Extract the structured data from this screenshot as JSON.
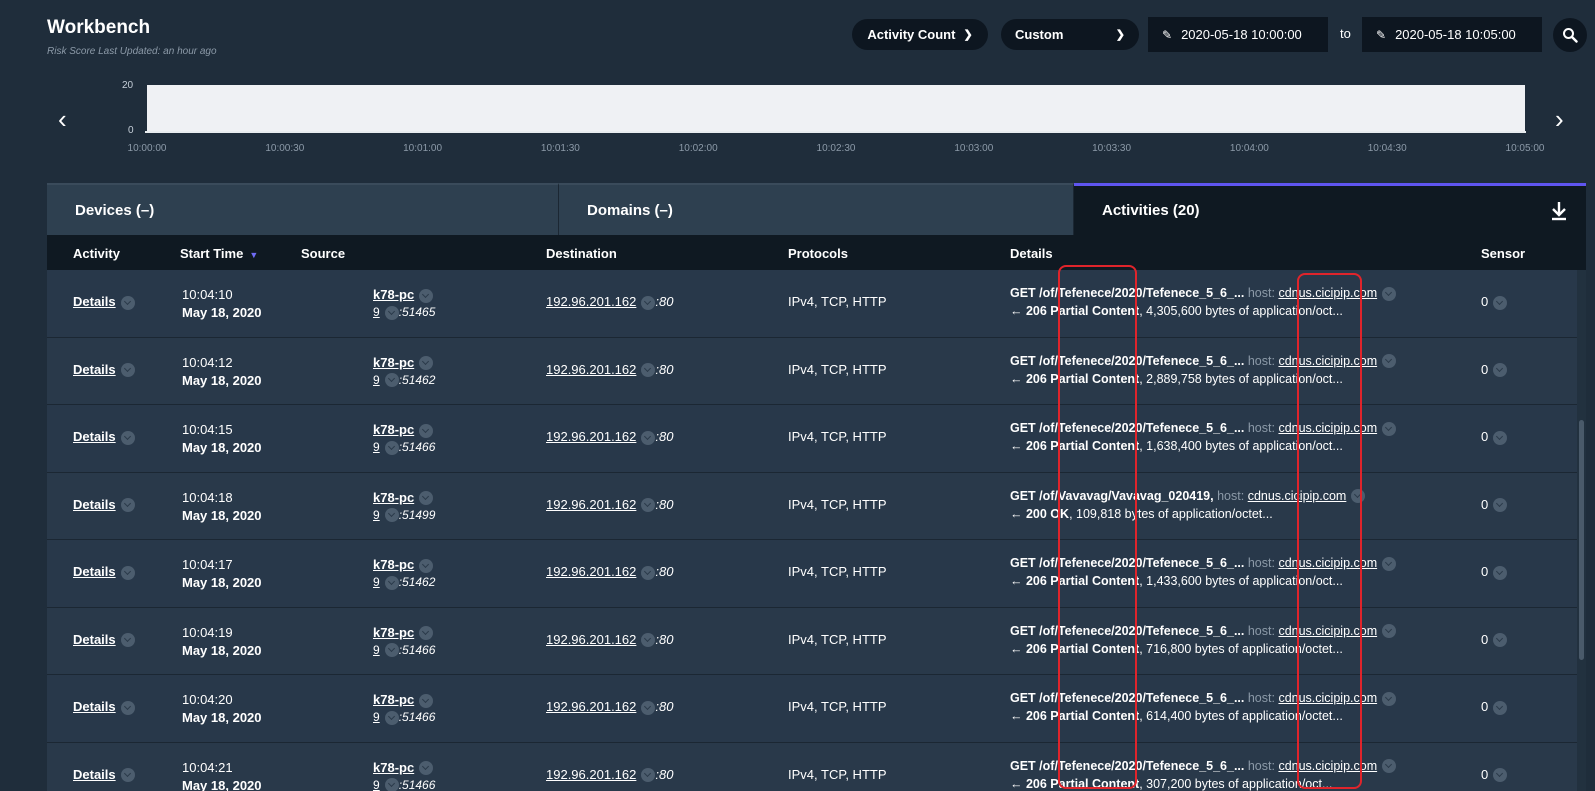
{
  "header": {
    "title": "Workbench",
    "subtitle": "Risk Score Last Updated: an hour ago"
  },
  "controls": {
    "metric_label": "Activity Count",
    "range_label": "Custom",
    "date_from": "2020-05-18 10:00:00",
    "to_label": "to",
    "date_to": "2020-05-18 10:05:00"
  },
  "timeline": {
    "y_ticks": [
      "20",
      "0"
    ],
    "x_ticks": [
      "10:00:00",
      "10:00:30",
      "10:01:00",
      "10:01:30",
      "10:02:00",
      "10:02:30",
      "10:03:00",
      "10:03:30",
      "10:04:00",
      "10:04:30",
      "10:05:00"
    ]
  },
  "tabs": {
    "devices": "Devices (–)",
    "domains": "Domains (–)",
    "activities": "Activities (20)"
  },
  "columns": {
    "activity": "Activity",
    "start_time": "Start Time",
    "source": "Source",
    "destination": "Destination",
    "protocols": "Protocols",
    "details": "Details",
    "sensor": "Sensor"
  },
  "rows": [
    {
      "link": "Details",
      "time": "10:04:10",
      "date": "May 18, 2020",
      "src_host": "k78-pc",
      "src_id": "9",
      "src_port": ":51465",
      "dst_ip": "192.96.201.162",
      "dst_port": ":80",
      "protocols": "IPv4, TCP, HTTP",
      "req": "GET /of/Tefenece/2020/Tefenece_5_6_...",
      "host_label": "host:",
      "host": "cdnus.cicipip.com",
      "status": "← 206 Partial Content",
      "resp": ", 4,305,600 bytes of application/oct...",
      "sensor": "0"
    },
    {
      "link": "Details",
      "time": "10:04:12",
      "date": "May 18, 2020",
      "src_host": "k78-pc",
      "src_id": "9",
      "src_port": ":51462",
      "dst_ip": "192.96.201.162",
      "dst_port": ":80",
      "protocols": "IPv4, TCP, HTTP",
      "req": "GET /of/Tefenece/2020/Tefenece_5_6_...",
      "host_label": "host:",
      "host": "cdnus.cicipip.com",
      "status": "← 206 Partial Content",
      "resp": ", 2,889,758 bytes of application/oct...",
      "sensor": "0"
    },
    {
      "link": "Details",
      "time": "10:04:15",
      "date": "May 18, 2020",
      "src_host": "k78-pc",
      "src_id": "9",
      "src_port": ":51466",
      "dst_ip": "192.96.201.162",
      "dst_port": ":80",
      "protocols": "IPv4, TCP, HTTP",
      "req": "GET /of/Tefenece/2020/Tefenece_5_6_...",
      "host_label": "host:",
      "host": "cdnus.cicipip.com",
      "status": "← 206 Partial Content",
      "resp": ", 1,638,400 bytes of application/oct...",
      "sensor": "0"
    },
    {
      "link": "Details",
      "time": "10:04:18",
      "date": "May 18, 2020",
      "src_host": "k78-pc",
      "src_id": "9",
      "src_port": ":51499",
      "dst_ip": "192.96.201.162",
      "dst_port": ":80",
      "protocols": "IPv4, TCP, HTTP",
      "req": "GET /of/Vavavag/Vavavag_020419,",
      "host_label": "host:",
      "host": "cdnus.cicipip.com",
      "status": "← 200 OK",
      "resp": ", 109,818 bytes of application/octet...",
      "sensor": "0"
    },
    {
      "link": "Details",
      "time": "10:04:17",
      "date": "May 18, 2020",
      "src_host": "k78-pc",
      "src_id": "9",
      "src_port": ":51462",
      "dst_ip": "192.96.201.162",
      "dst_port": ":80",
      "protocols": "IPv4, TCP, HTTP",
      "req": "GET /of/Tefenece/2020/Tefenece_5_6_...",
      "host_label": "host:",
      "host": "cdnus.cicipip.com",
      "status": "← 206 Partial Content",
      "resp": ", 1,433,600 bytes of application/oct...",
      "sensor": "0"
    },
    {
      "link": "Details",
      "time": "10:04:19",
      "date": "May 18, 2020",
      "src_host": "k78-pc",
      "src_id": "9",
      "src_port": ":51466",
      "dst_ip": "192.96.201.162",
      "dst_port": ":80",
      "protocols": "IPv4, TCP, HTTP",
      "req": "GET /of/Tefenece/2020/Tefenece_5_6_...",
      "host_label": "host:",
      "host": "cdnus.cicipip.com",
      "status": "← 206 Partial Content",
      "resp": ", 716,800 bytes of application/octet...",
      "sensor": "0"
    },
    {
      "link": "Details",
      "time": "10:04:20",
      "date": "May 18, 2020",
      "src_host": "k78-pc",
      "src_id": "9",
      "src_port": ":51466",
      "dst_ip": "192.96.201.162",
      "dst_port": ":80",
      "protocols": "IPv4, TCP, HTTP",
      "req": "GET /of/Tefenece/2020/Tefenece_5_6_...",
      "host_label": "host:",
      "host": "cdnus.cicipip.com",
      "status": "← 206 Partial Content",
      "resp": ", 614,400 bytes of application/octet...",
      "sensor": "0"
    },
    {
      "link": "Details",
      "time": "10:04:21",
      "date": "May 18, 2020",
      "src_host": "k78-pc",
      "src_id": "9",
      "src_port": ":51466",
      "dst_ip": "192.96.201.162",
      "dst_port": ":80",
      "protocols": "IPv4, TCP, HTTP",
      "req": "GET /of/Tefenece/2020/Tefenece_5_6_...",
      "host_label": "host:",
      "host": "cdnus.cicipip.com",
      "status": "← 206 Partial Content",
      "resp": ", 307,200 bytes of application/oct...",
      "sensor": "0"
    }
  ],
  "colors": {
    "background": "#1f2d3b",
    "active_tab_accent": "#5f55f0",
    "highlight": "#e0242b"
  }
}
